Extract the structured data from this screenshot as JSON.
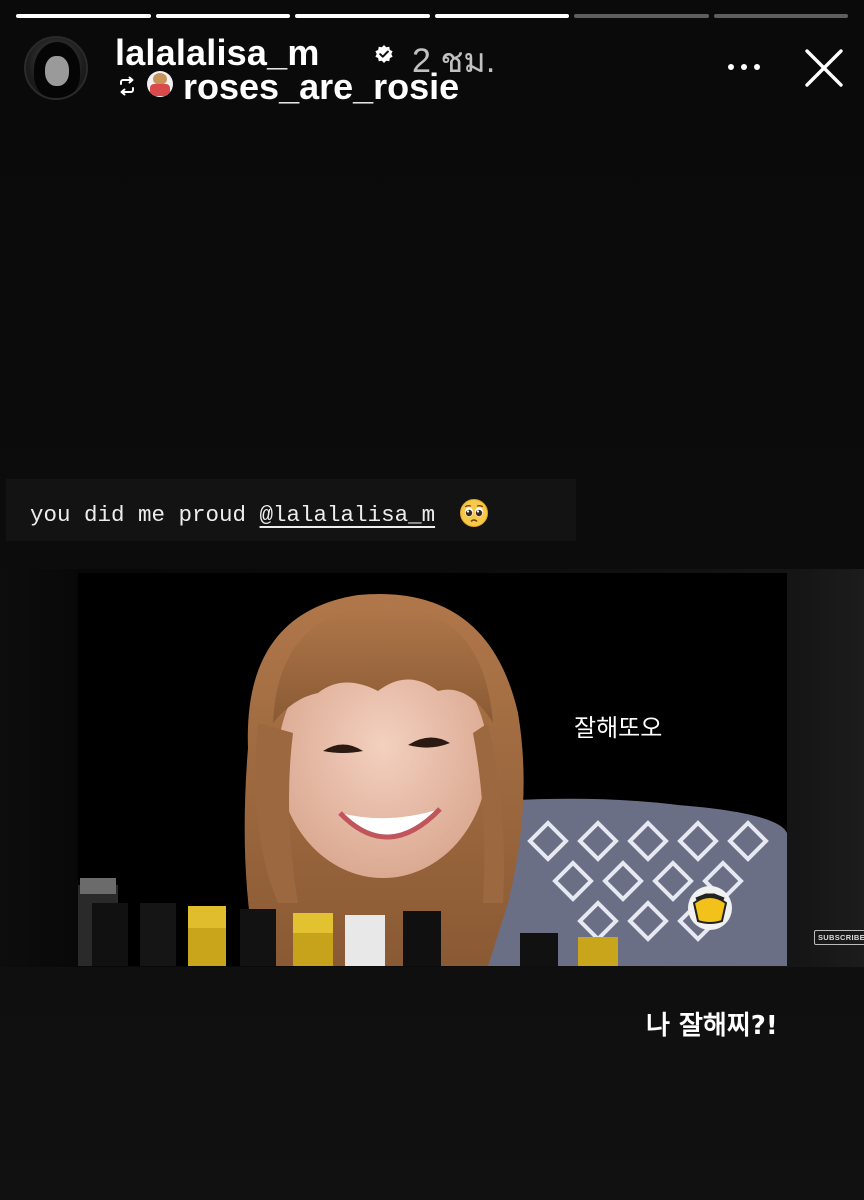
{
  "story": {
    "segments": [
      1,
      1,
      1,
      1,
      0,
      0
    ],
    "author": {
      "username": "lalalalisa_m",
      "verified": true,
      "time_ago": "2 ชม.",
      "avatar_icon": "profile-photo"
    },
    "reposted_from": {
      "username": "roses_are_rosie",
      "repost_icon": "repost-icon"
    },
    "actions": {
      "more_icon": "more-dots-icon",
      "close_icon": "close-icon"
    }
  },
  "caption": {
    "prefix": "you did me proud ",
    "mention": "@lalalalisa_m",
    "emoji": "pleading-face-emoji"
  },
  "video": {
    "overlay_text": "잘해또오",
    "subscribe_label": "SUBSCRIBE"
  },
  "bottom_text": "나 잘해찌?!",
  "colors": {
    "background": "#0b0b0b",
    "progress_active": "#ffffff",
    "progress_inactive": "#5a5a5a",
    "verified_badge": "#ffffff"
  }
}
